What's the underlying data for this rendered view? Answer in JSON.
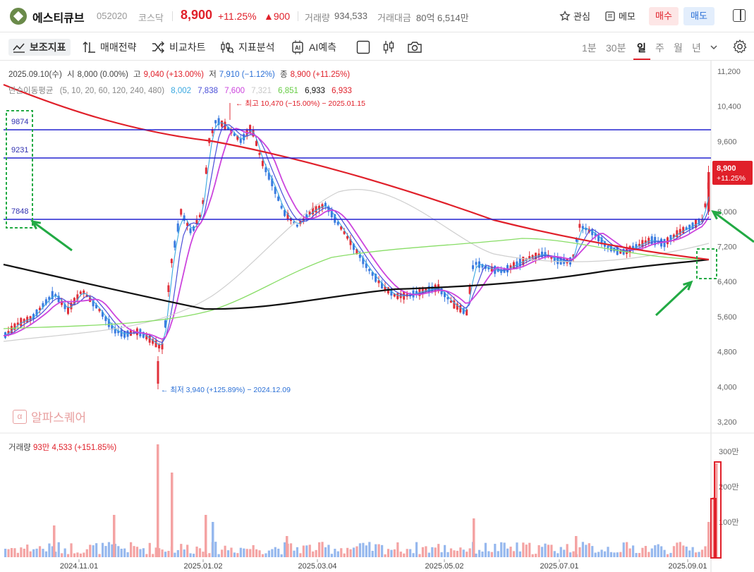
{
  "header": {
    "name": "에스티큐브",
    "code": "052020",
    "market": "코스닥",
    "price": "8,900",
    "change_pct": "+11.25%",
    "change_abs": "▲900",
    "volume_label": "거래량",
    "volume": "934,533",
    "amount_label": "거래대금",
    "amount": "80억 6,514만",
    "watch_label": "관심",
    "memo_label": "메모",
    "buy_label": "매수",
    "sell_label": "매도"
  },
  "toolbar": {
    "indicator": "보조지표",
    "strategy": "매매전략",
    "compare": "비교차트",
    "analysis": "지표분석",
    "ai": "AI예측",
    "periods": [
      "1분",
      "30분",
      "일",
      "주",
      "월",
      "년"
    ],
    "active_period": "일"
  },
  "chart_info": {
    "date": "2025.09.10(수)",
    "open_label": "시",
    "open": "8,000 (0.00%)",
    "high_label": "고",
    "high": "9,040 (+13.00%)",
    "low_label": "저",
    "low": "7,910 (−1.12%)",
    "close_label": "종",
    "close": "8,900 (+11.25%)",
    "ma_label": "단순이동평균",
    "ma_periods": "(5, 10, 20, 60, 120, 240, 480)",
    "ma_values": [
      "8,002",
      "7,838",
      "7,600",
      "7,321",
      "6,851",
      "6,933",
      "6,933"
    ],
    "ma_colors": [
      "#39a8e0",
      "#4b4fd8",
      "#cc44dd",
      "#c8c8c8",
      "#88dd66",
      "#111111",
      "#e0202a"
    ],
    "high_marker": "최고 10,470 (−15.00%) − 2025.01.15",
    "low_marker": "최저 3,940 (+125.89%) − 2024.12.09",
    "price_tag": "8,900",
    "price_tag_pct": "+11.25%",
    "level_labels": [
      "9874",
      "9231",
      "7848"
    ],
    "levels": [
      9874,
      9231,
      7848
    ],
    "watermark": "알파스퀘어"
  },
  "volume_info": {
    "label": "거래량",
    "value": "93만 4,533 (+151.85%)"
  },
  "chart_data": {
    "type": "candlestick",
    "price_axis": [
      "11,200",
      "10,400",
      "9,600",
      "8,800",
      "8,000",
      "7,200",
      "6,400",
      "5,600",
      "4,800",
      "4,000",
      "3,200"
    ],
    "price_ticks": [
      11200,
      10400,
      9600,
      8800,
      8000,
      7200,
      6400,
      5600,
      4800,
      4000,
      3200
    ],
    "volume_axis": [
      "300만",
      "200만",
      "100만"
    ],
    "volume_ticks": [
      3000000,
      2000000,
      1000000
    ],
    "x_labels": [
      "2024.11.01",
      "2025.01.02",
      "2025.03.04",
      "2025.05.02",
      "2025.07.01",
      "2025.09.01"
    ],
    "ylim": [
      3200,
      11200
    ],
    "colors": {
      "up": "#e0303a",
      "down": "#3a7be0",
      "vol_up": "#f4a3a3",
      "vol_down": "#96b8ee"
    }
  }
}
